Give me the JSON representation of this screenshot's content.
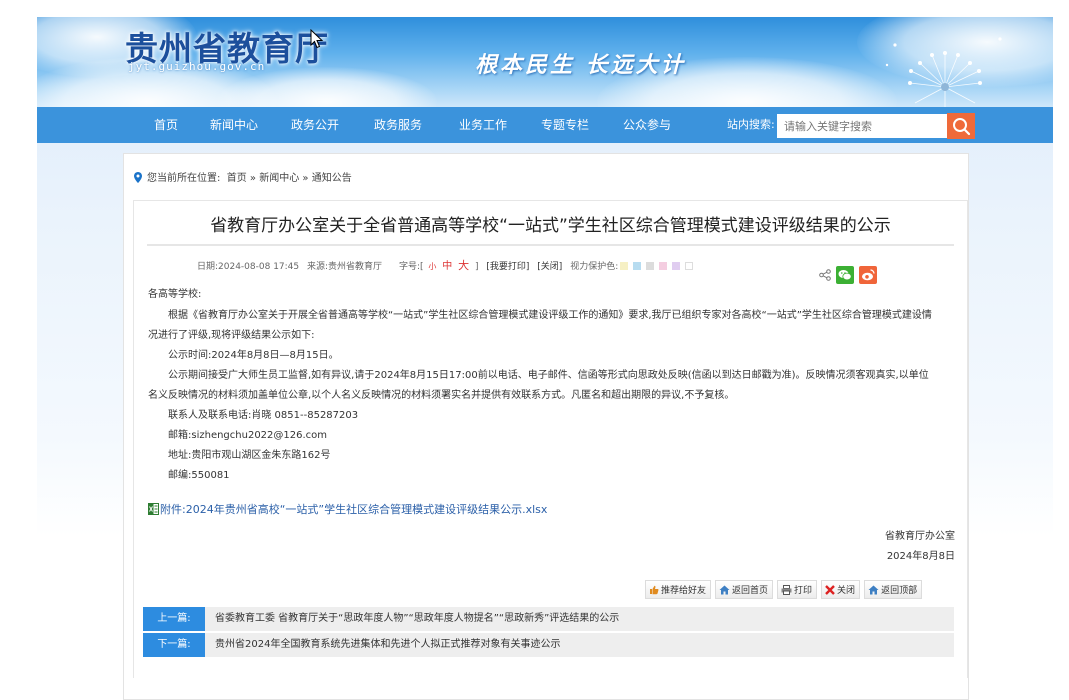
{
  "header": {
    "site_title": "贵州省教育厅",
    "site_url": "jyt.guizhou.gov.cn",
    "slogan": "根本民生 长远大计"
  },
  "nav": {
    "items": [
      "首页",
      "新闻中心",
      "政务公开",
      "政务服务",
      "业务工作",
      "专题专栏",
      "公众参与"
    ],
    "search_label": "站内搜索:",
    "search_placeholder": "请输入关键字搜索",
    "search_icon": "search-icon"
  },
  "breadcrumb": {
    "prefix": "您当前所在位置:",
    "items": [
      "首页",
      "新闻中心",
      "通知公告"
    ],
    "separator": "»"
  },
  "article": {
    "title": "省教育厅办公室关于全省普通高等学校“一站式”学生社区综合管理模式建设评级结果的公示",
    "meta": {
      "date": "日期:2024-08-08 17:45",
      "source": "来源:贵州省教育厅",
      "fontsize_label": "字号:[",
      "fs_small": "小",
      "fs_mid": "中",
      "fs_big": "大",
      "fontsize_end": "]",
      "print": "[我要打印]",
      "close": "[关闭]",
      "eye_label": "视力保护色:",
      "swatches": [
        "#f6f0c4",
        "#b7dcf0",
        "#dcdcdc",
        "#f4cde0",
        "#e0cdf0",
        "#ffffff"
      ]
    },
    "share_icons": [
      "share-icon",
      "wechat-icon",
      "weibo-icon"
    ],
    "greeting": "各高等学校:",
    "para1_line1": "根据《省教育厅办公室关于开展全省普通高等学校“一站式”学生社区综合管理模式建设评级工作的通知》要求,我厅已组织专家对各高校“一站式”学生社区综合管理模式建设情",
    "para1_line2": "况进行了评级,现将评级结果公示如下:",
    "period": "公示时间:2024年8月8日—8月15日。",
    "para3_line1": "公示期间接受广大师生员工监督,如有异议,请于2024年8月15日17:00前以电话、电子邮件、信函等形式向思政处反映(信函以到达日邮戳为准)。反映情况须客观真实,以单位",
    "para3_line2": "名义反映情况的材料须加盖单位公章,以个人名义反映情况的材料须署实名并提供有效联系方式。凡匿名和超出期限的异议,不予复核。",
    "contact": "联系人及联系电话:肖晓 0851--85287203",
    "email": "邮箱:sizhengchu2022@126.com",
    "address": "地址:贵阳市观山湖区金朱东路162号",
    "postcode": "邮编:550081",
    "attachment": "附件:2024年贵州省高校“一站式”学生社区综合管理模式建设评级结果公示.xlsx",
    "signer": "省教育厅办公室",
    "sign_date": "2024年8月8日"
  },
  "tools": {
    "recommend": "推荐给好友",
    "home": "返回首页",
    "print": "打印",
    "close": "关闭",
    "top": "返回顶部"
  },
  "prevnext": {
    "prev_label": "上一篇:",
    "prev_title": "省委教育工委 省教育厅关于“思政年度人物”“思政年度人物提名”“思政新秀”评选结果的公示",
    "next_label": "下一篇:",
    "next_title": "贵州省2024年全国教育系统先进集体和先进个人拟正式推荐对象有关事迹公示"
  },
  "colors": {
    "nav_bg": "#3b93dc",
    "search_button": "#ef6a3a",
    "prevnext_tag": "#2d8ce0",
    "link": "#2a5fa8"
  }
}
